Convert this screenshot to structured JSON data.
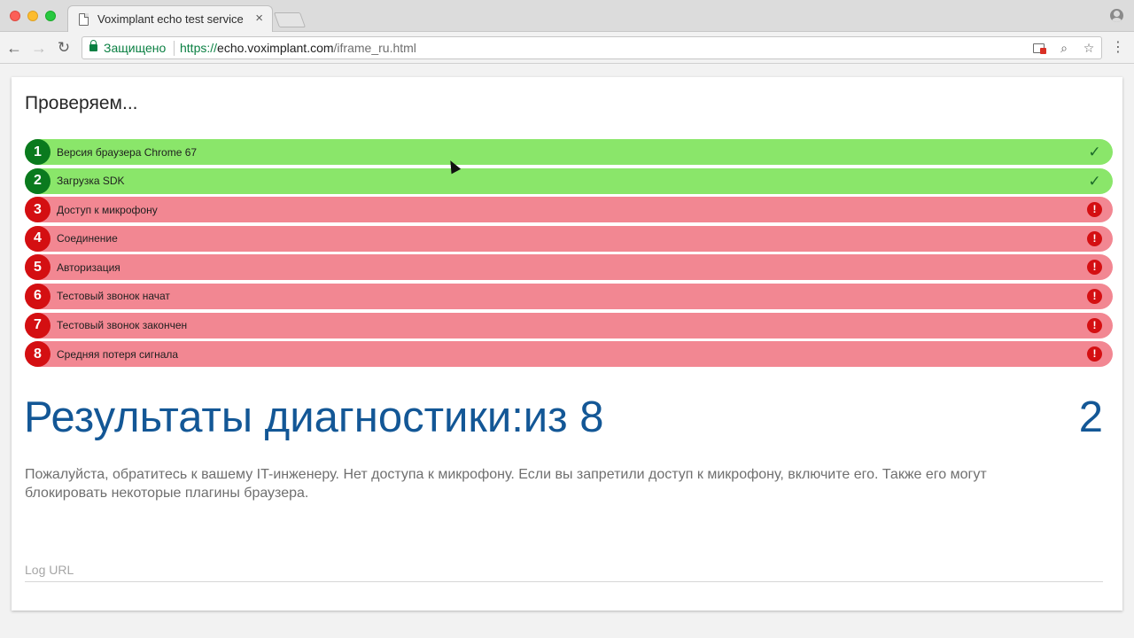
{
  "browser": {
    "tab_title": "Voximplant echo test service",
    "tab_close": "×",
    "secure_label": "Защищено",
    "url_scheme": "https://",
    "url_host": "echo.voximplant.com",
    "url_path": "/iframe_ru.html"
  },
  "page": {
    "checking_title": "Проверяем...",
    "steps": [
      {
        "num": "1",
        "label": "Версия браузера Chrome 67",
        "status": "ok"
      },
      {
        "num": "2",
        "label": "Загрузка SDK",
        "status": "ok"
      },
      {
        "num": "3",
        "label": "Доступ к микрофону",
        "status": "error"
      },
      {
        "num": "4",
        "label": "Соединение",
        "status": "error"
      },
      {
        "num": "5",
        "label": "Авторизация",
        "status": "error"
      },
      {
        "num": "6",
        "label": "Тестовый звонок начат",
        "status": "error"
      },
      {
        "num": "7",
        "label": "Тестовый звонок закончен",
        "status": "error"
      },
      {
        "num": "8",
        "label": "Средняя потеря сигнала",
        "status": "error"
      }
    ],
    "results_title": "Результаты диагностики:из 8",
    "results_score": "2",
    "advice": "Пожалуйста, обратитесь к вашему IT-инженеру. Нет доступа к микрофону. Если вы запретили доступ к микрофону, включите его. Также его могут блокировать некоторые плагины браузера.",
    "log_placeholder": "Log URL"
  },
  "colors": {
    "ok_bar": "#8ae66a",
    "ok_badge": "#0a7a1e",
    "error_bar": "#f28792",
    "error_badge": "#d40f12",
    "results_text": "#135796"
  },
  "icons": {
    "ok": "checkmark-icon",
    "error": "alert-icon"
  }
}
